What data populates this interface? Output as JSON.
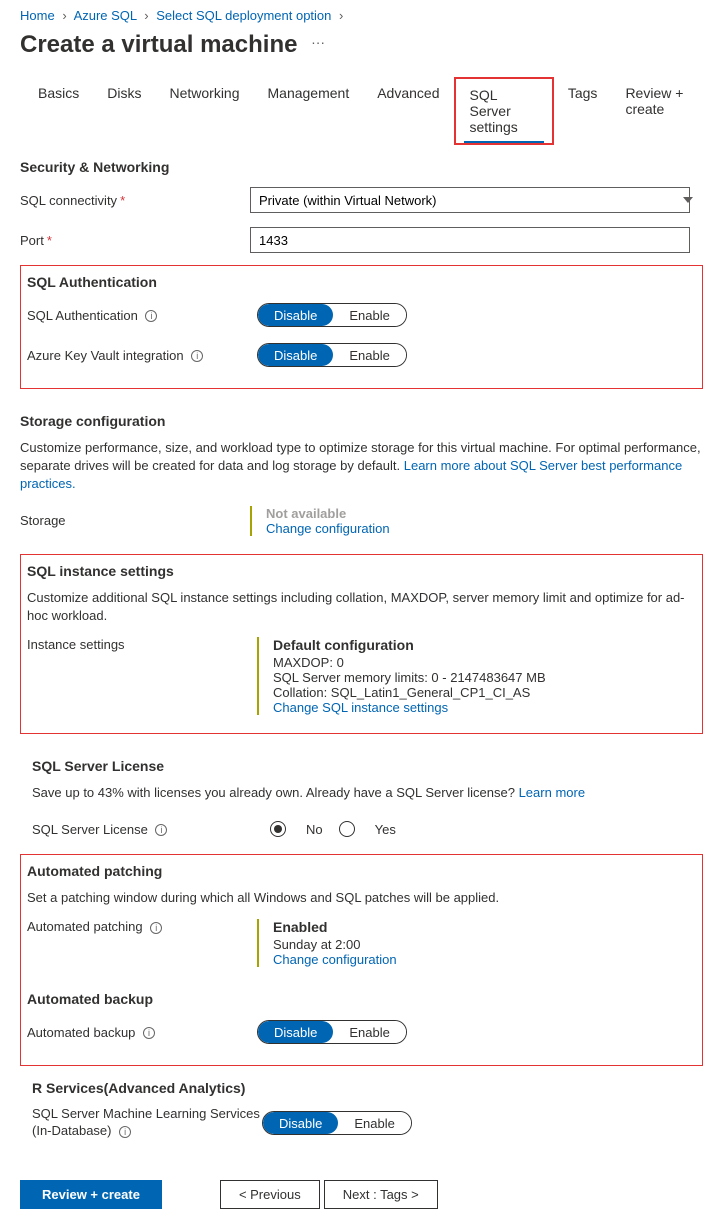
{
  "breadcrumb": {
    "items": [
      "Home",
      "Azure SQL",
      "Select SQL deployment option"
    ]
  },
  "page": {
    "title": "Create a virtual machine"
  },
  "tabs": {
    "items": [
      {
        "label": "Basics"
      },
      {
        "label": "Disks"
      },
      {
        "label": "Networking"
      },
      {
        "label": "Management"
      },
      {
        "label": "Advanced"
      },
      {
        "label": "SQL Server settings",
        "active": true,
        "highlight": true
      },
      {
        "label": "Tags"
      },
      {
        "label": "Review + create"
      }
    ]
  },
  "security": {
    "heading": "Security & Networking",
    "connectivity_label": "SQL connectivity",
    "connectivity_value": "Private (within Virtual Network)",
    "port_label": "Port",
    "port_value": "1433"
  },
  "auth": {
    "heading": "SQL Authentication",
    "sql_auth_label": "SQL Authentication",
    "akv_label": "Azure Key Vault integration",
    "disable": "Disable",
    "enable": "Enable"
  },
  "storage": {
    "heading": "Storage configuration",
    "desc_a": "Customize performance, size, and workload type to optimize storage for this virtual machine. For optimal performance, separate drives will be created for data and log storage by default. ",
    "desc_link": "Learn more about SQL Server best performance practices.",
    "label": "Storage",
    "value": "Not available",
    "change": "Change configuration"
  },
  "instance": {
    "heading": "SQL instance settings",
    "desc": "Customize additional SQL instance settings including collation, MAXDOP, server memory limit and optimize for ad-hoc workload.",
    "label": "Instance settings",
    "default": "Default configuration",
    "maxdop": "MAXDOP: 0",
    "memory": "SQL Server memory limits: 0 - 2147483647 MB",
    "collation": "Collation: SQL_Latin1_General_CP1_CI_AS",
    "change": "Change SQL instance settings"
  },
  "license": {
    "heading": "SQL Server License",
    "desc": "Save up to 43% with licenses you already own. Already have a SQL Server license? ",
    "learn_more": "Learn more",
    "label": "SQL Server License",
    "no": "No",
    "yes": "Yes"
  },
  "patching": {
    "heading": "Automated patching",
    "desc": "Set a patching window during which all Windows and SQL patches will be applied.",
    "label": "Automated patching",
    "enabled": "Enabled",
    "schedule": "Sunday at 2:00",
    "change": "Change configuration"
  },
  "backup": {
    "heading": "Automated backup",
    "label": "Automated backup"
  },
  "rservices": {
    "heading": "R Services(Advanced Analytics)",
    "label": "SQL Server Machine Learning Services (In-Database)"
  },
  "buttons": {
    "review": "Review + create",
    "previous": "< Previous",
    "next": "Next : Tags >"
  }
}
